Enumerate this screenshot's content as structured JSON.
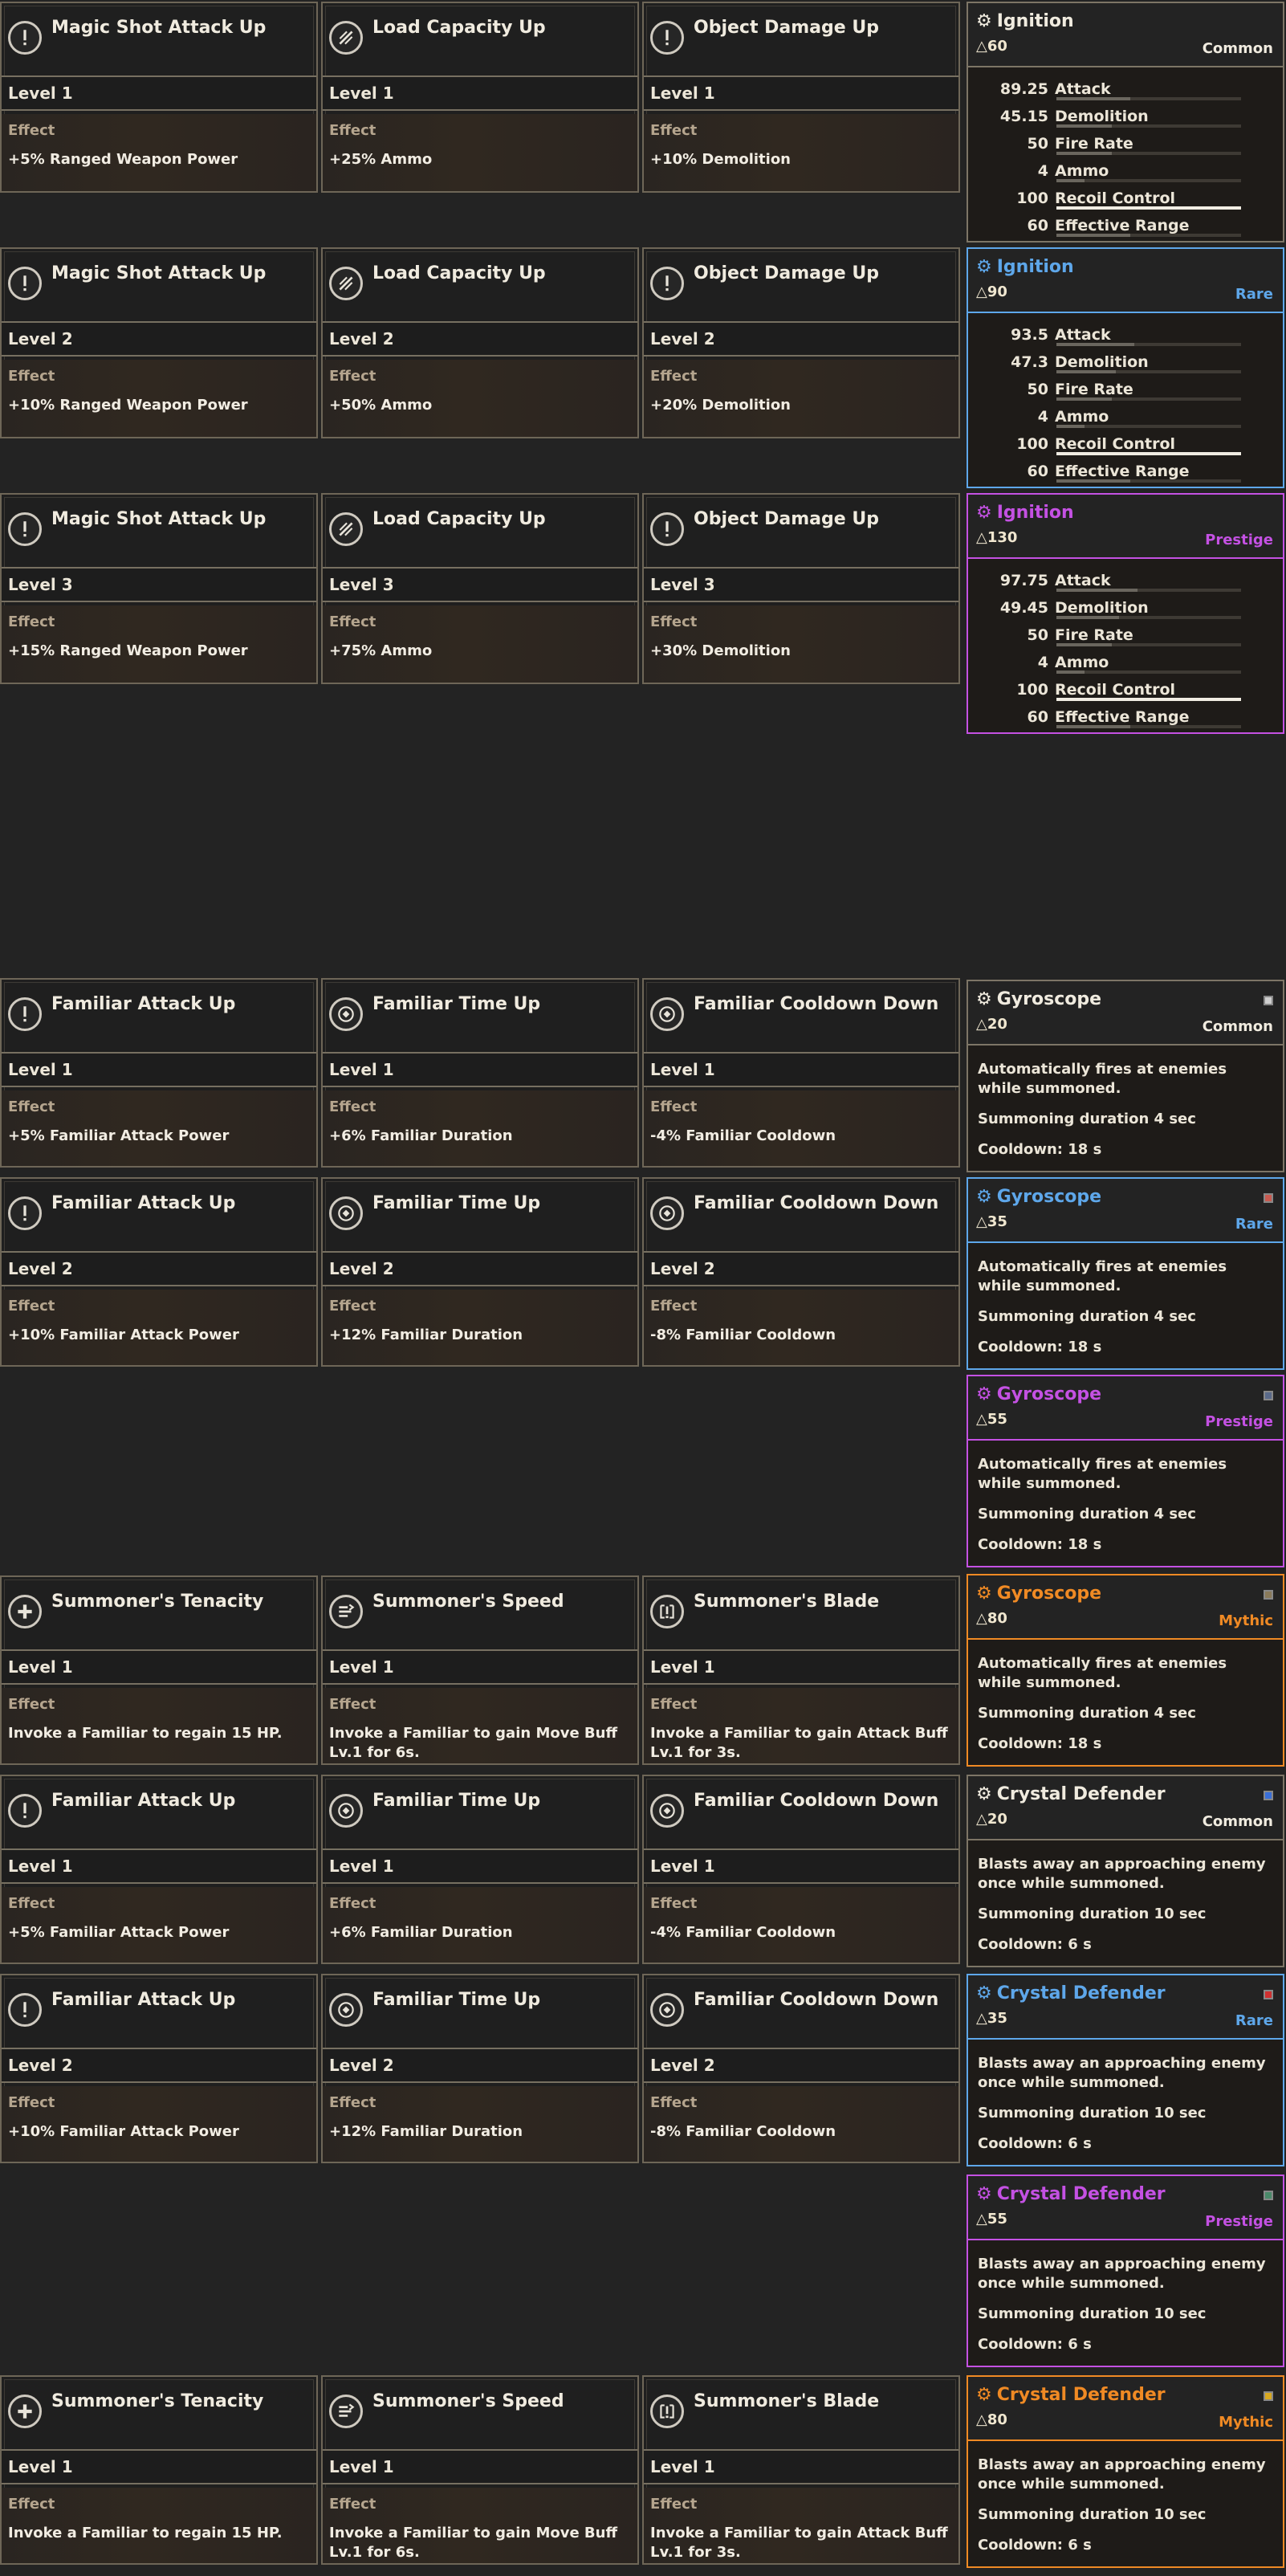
{
  "ignition_sets": [
    {
      "mods": [
        {
          "title": "Magic Shot Attack Up",
          "icon": "exclamation-icon",
          "level": "Level 1",
          "effect_label": "Effect",
          "effect": "+5% Ranged Weapon Power"
        },
        {
          "title": "Load Capacity Up",
          "icon": "ammo-icon",
          "level": "Level 1",
          "effect_label": "Effect",
          "effect": "+25% Ammo"
        },
        {
          "title": "Object Damage Up",
          "icon": "exclamation-icon",
          "level": "Level 1",
          "effect_label": "Effect",
          "effect": "+10% Demolition"
        }
      ],
      "weapon": {
        "name": "Ignition",
        "cost": "△60",
        "rarity": "Common",
        "color": "#f0ebdf",
        "stats": [
          {
            "value": "89.25",
            "name": "Attack",
            "fill": 0.4
          },
          {
            "value": "45.15",
            "name": "Demolition",
            "fill": 0.3
          },
          {
            "value": "50",
            "name": "Fire Rate",
            "fill": 0.3
          },
          {
            "value": "4",
            "name": "Ammo",
            "fill": 0.15
          },
          {
            "value": "100",
            "name": "Recoil Control",
            "fill": 1.0
          },
          {
            "value": "60",
            "name": "Effective Range",
            "fill": 0.4
          }
        ]
      }
    },
    {
      "mods": [
        {
          "title": "Magic Shot Attack Up",
          "icon": "exclamation-icon",
          "level": "Level 2",
          "effect_label": "Effect",
          "effect": "+10% Ranged Weapon Power"
        },
        {
          "title": "Load Capacity Up",
          "icon": "ammo-icon",
          "level": "Level 2",
          "effect_label": "Effect",
          "effect": "+50% Ammo"
        },
        {
          "title": "Object Damage Up",
          "icon": "exclamation-icon",
          "level": "Level 2",
          "effect_label": "Effect",
          "effect": "+20% Demolition"
        }
      ],
      "weapon": {
        "name": "Ignition",
        "cost": "△90",
        "rarity": "Rare",
        "color": "#5ea7ea",
        "stats": [
          {
            "value": "93.5",
            "name": "Attack",
            "fill": 0.42
          },
          {
            "value": "47.3",
            "name": "Demolition",
            "fill": 0.32
          },
          {
            "value": "50",
            "name": "Fire Rate",
            "fill": 0.3
          },
          {
            "value": "4",
            "name": "Ammo",
            "fill": 0.15
          },
          {
            "value": "100",
            "name": "Recoil Control",
            "fill": 1.0
          },
          {
            "value": "60",
            "name": "Effective Range",
            "fill": 0.4
          }
        ]
      }
    },
    {
      "mods": [
        {
          "title": "Magic Shot Attack Up",
          "icon": "exclamation-icon",
          "level": "Level 3",
          "effect_label": "Effect",
          "effect": "+15% Ranged Weapon Power"
        },
        {
          "title": "Load Capacity Up",
          "icon": "ammo-icon",
          "level": "Level 3",
          "effect_label": "Effect",
          "effect": "+75% Ammo"
        },
        {
          "title": "Object Damage Up",
          "icon": "exclamation-icon",
          "level": "Level 3",
          "effect_label": "Effect",
          "effect": "+30% Demolition"
        }
      ],
      "weapon": {
        "name": "Ignition",
        "cost": "△130",
        "rarity": "Prestige",
        "color": "#c451e3",
        "stats": [
          {
            "value": "97.75",
            "name": "Attack",
            "fill": 0.44
          },
          {
            "value": "49.45",
            "name": "Demolition",
            "fill": 0.34
          },
          {
            "value": "50",
            "name": "Fire Rate",
            "fill": 0.3
          },
          {
            "value": "4",
            "name": "Ammo",
            "fill": 0.15
          },
          {
            "value": "100",
            "name": "Recoil Control",
            "fill": 1.0
          },
          {
            "value": "60",
            "name": "Effective Range",
            "fill": 0.4
          }
        ]
      }
    }
  ],
  "familiar_rows": [
    {
      "mods": [
        {
          "title": "Familiar Attack Up",
          "icon": "exclamation-icon",
          "level": "Level 1",
          "effect_label": "Effect",
          "effect": "+5% Familiar Attack Power"
        },
        {
          "title": "Familiar Time Up",
          "icon": "target-icon",
          "level": "Level 1",
          "effect_label": "Effect",
          "effect": "+6% Familiar Duration"
        },
        {
          "title": "Familiar Cooldown Down",
          "icon": "target-icon",
          "level": "Level 1",
          "effect_label": "Effect",
          "effect": "-4% Familiar Cooldown"
        }
      ]
    },
    {
      "mods": [
        {
          "title": "Familiar Attack Up",
          "icon": "exclamation-icon",
          "level": "Level 2",
          "effect_label": "Effect",
          "effect": "+10% Familiar Attack Power"
        },
        {
          "title": "Familiar Time Up",
          "icon": "target-icon",
          "level": "Level 2",
          "effect_label": "Effect",
          "effect": "+12% Familiar Duration"
        },
        {
          "title": "Familiar Cooldown Down",
          "icon": "target-icon",
          "level": "Level 2",
          "effect_label": "Effect",
          "effect": "-8% Familiar Cooldown"
        }
      ]
    },
    {
      "mods": [
        {
          "title": "Summoner's Tenacity",
          "icon": "plus-icon",
          "level": "Level 1",
          "effect_label": "Effect",
          "effect": "Invoke a Familiar to regain 15 HP."
        },
        {
          "title": "Summoner's Speed",
          "icon": "speed-icon",
          "level": "Level 1",
          "effect_label": "Effect",
          "effect": "Invoke a Familiar to gain Move Buff Lv.1 for 6s."
        },
        {
          "title": "Summoner's Blade",
          "icon": "blade-icon",
          "level": "Level 1",
          "effect_label": "Effect",
          "effect": "Invoke a Familiar to gain Attack Buff Lv.1 for 3s."
        }
      ]
    },
    {
      "mods": [
        {
          "title": "Familiar Attack Up",
          "icon": "exclamation-icon",
          "level": "Level 1",
          "effect_label": "Effect",
          "effect": "+5% Familiar Attack Power"
        },
        {
          "title": "Familiar Time Up",
          "icon": "target-icon",
          "level": "Level 1",
          "effect_label": "Effect",
          "effect": "+6% Familiar Duration"
        },
        {
          "title": "Familiar Cooldown Down",
          "icon": "target-icon",
          "level": "Level 1",
          "effect_label": "Effect",
          "effect": "-4% Familiar Cooldown"
        }
      ]
    },
    {
      "mods": [
        {
          "title": "Familiar Attack Up",
          "icon": "exclamation-icon",
          "level": "Level 2",
          "effect_label": "Effect",
          "effect": "+10% Familiar Attack Power"
        },
        {
          "title": "Familiar Time Up",
          "icon": "target-icon",
          "level": "Level 2",
          "effect_label": "Effect",
          "effect": "+12% Familiar Duration"
        },
        {
          "title": "Familiar Cooldown Down",
          "icon": "target-icon",
          "level": "Level 2",
          "effect_label": "Effect",
          "effect": "-8% Familiar Cooldown"
        }
      ]
    },
    {
      "mods": [
        {
          "title": "Summoner's Tenacity",
          "icon": "plus-icon",
          "level": "Level 1",
          "effect_label": "Effect",
          "effect": "Invoke a Familiar to regain 15 HP."
        },
        {
          "title": "Summoner's Speed",
          "icon": "speed-icon",
          "level": "Level 1",
          "effect_label": "Effect",
          "effect": "Invoke a Familiar to gain Move Buff Lv.1 for 6s."
        },
        {
          "title": "Summoner's Blade",
          "icon": "blade-icon",
          "level": "Level 1",
          "effect_label": "Effect",
          "effect": "Invoke a Familiar to gain Attack Buff Lv.1 for 3s."
        }
      ]
    }
  ],
  "familiar_weapons": [
    {
      "name": "Gyroscope",
      "cost": "△20",
      "rarity": "Common",
      "color": "#f0ebdf",
      "dot": "#cfcfcf",
      "desc": "Automatically fires at enemies while summoned.",
      "duration": "Summoning duration 4 sec",
      "cooldown": "Cooldown: 18 s"
    },
    {
      "name": "Gyroscope",
      "cost": "△35",
      "rarity": "Rare",
      "color": "#5ea7ea",
      "dot": "#c85a50",
      "desc": "Automatically fires at enemies while summoned.",
      "duration": "Summoning duration 4 sec",
      "cooldown": "Cooldown: 18 s"
    },
    {
      "name": "Gyroscope",
      "cost": "△55",
      "rarity": "Prestige",
      "color": "#c451e3",
      "dot": "#5a6a8a",
      "desc": "Automatically fires at enemies while summoned.",
      "duration": "Summoning duration 4 sec",
      "cooldown": "Cooldown: 18 s"
    },
    {
      "name": "Gyroscope",
      "cost": "△80",
      "rarity": "Mythic",
      "color": "#f08a24",
      "dot": "#8a7a5a",
      "desc": "Automatically fires at enemies while summoned.",
      "duration": "Summoning duration 4 sec",
      "cooldown": "Cooldown: 18 s"
    },
    {
      "name": "Crystal Defender",
      "cost": "△20",
      "rarity": "Common",
      "color": "#f0ebdf",
      "dot": "#3a6fd8",
      "desc": "Blasts away an approaching enemy once while summoned.",
      "duration": "Summoning duration 10 sec",
      "cooldown": "Cooldown: 6 s"
    },
    {
      "name": "Crystal Defender",
      "cost": "△35",
      "rarity": "Rare",
      "color": "#5ea7ea",
      "dot": "#d03030",
      "desc": "Blasts away an approaching enemy once while summoned.",
      "duration": "Summoning duration 10 sec",
      "cooldown": "Cooldown: 6 s"
    },
    {
      "name": "Crystal Defender",
      "cost": "△55",
      "rarity": "Prestige",
      "color": "#c451e3",
      "dot": "#4a8a6a",
      "desc": "Blasts away an approaching enemy once while summoned.",
      "duration": "Summoning duration 10 sec",
      "cooldown": "Cooldown: 6 s"
    },
    {
      "name": "Crystal Defender",
      "cost": "△80",
      "rarity": "Mythic",
      "color": "#f08a24",
      "dot": "#d8a820",
      "desc": "Blasts away an approaching enemy once while summoned.",
      "duration": "Summoning duration 10 sec",
      "cooldown": "Cooldown: 6 s"
    }
  ]
}
